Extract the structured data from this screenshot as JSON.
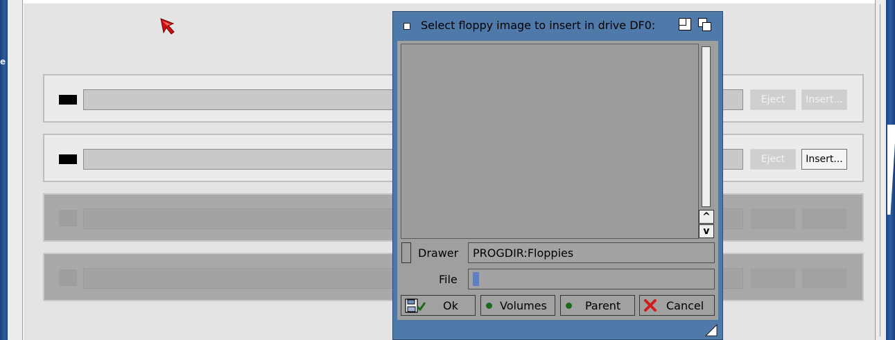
{
  "desktop": {
    "left_label": "e"
  },
  "drives": [
    {
      "eject_label": "Eject",
      "insert_label": "Insert...",
      "insert_enabled": false
    },
    {
      "eject_label": "Eject",
      "insert_label": "Insert...",
      "insert_enabled": true
    },
    {
      "eject_label": "",
      "insert_label": "",
      "insert_enabled": false
    },
    {
      "eject_label": "",
      "insert_label": "",
      "insert_enabled": false
    }
  ],
  "dialog": {
    "title": "Select floppy image to insert in drive DF0:",
    "scroll_up_label": "^",
    "scroll_down_label": "v",
    "drawer_label": "Drawer",
    "drawer_value": "PROGDIR:Floppies",
    "file_label": "File",
    "file_value": "",
    "buttons": {
      "ok": "Ok",
      "volumes": "Volumes",
      "parent": "Parent",
      "cancel": "Cancel"
    }
  },
  "colors": {
    "dialog_frame": "#4f79a9",
    "panel_gray": "#9f9f9f",
    "status_dot": "#1b6a1b",
    "cancel_red": "#d11c1c",
    "cursor_red": "#cc1010"
  },
  "icons": [
    "mouse-pointer-icon",
    "close-gadget-icon",
    "zoom-gadget-icon",
    "depth-gadget-icon",
    "disk-ok-icon",
    "cancel-x-icon",
    "resize-gadget-icon"
  ]
}
